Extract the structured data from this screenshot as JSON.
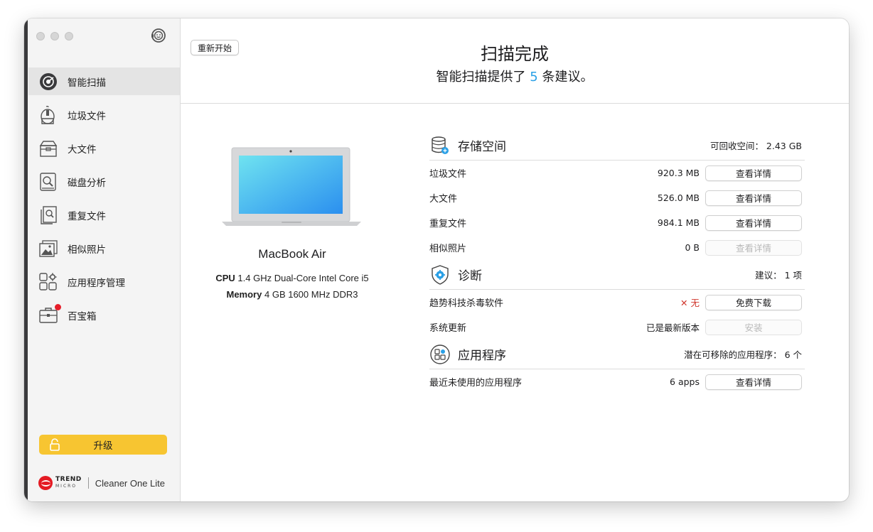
{
  "sidebar": {
    "items": [
      {
        "label": "智能扫描",
        "icon": "smart-scan-icon",
        "active": true
      },
      {
        "label": "垃圾文件",
        "icon": "junk-files-icon"
      },
      {
        "label": "大文件",
        "icon": "big-files-icon"
      },
      {
        "label": "磁盘分析",
        "icon": "disk-analysis-icon"
      },
      {
        "label": "重复文件",
        "icon": "duplicate-files-icon"
      },
      {
        "label": "相似照片",
        "icon": "similar-photos-icon"
      },
      {
        "label": "应用程序管理",
        "icon": "app-manager-icon"
      },
      {
        "label": "百宝箱",
        "icon": "toolbox-icon",
        "badge": true
      }
    ],
    "upgrade_label": "升级",
    "brand": {
      "company_line1": "TREND",
      "company_line2": "MICRO",
      "product": "Cleaner One Lite"
    }
  },
  "header": {
    "restart_label": "重新开始",
    "title": "扫描完成",
    "subtitle_prefix": "智能扫描提供了",
    "subtitle_count": "5",
    "subtitle_suffix": "条建议。"
  },
  "device": {
    "name": "MacBook Air",
    "cpu_label": "CPU",
    "cpu_value": "1.4 GHz Dual-Core Intel Core i5",
    "memory_label": "Memory",
    "memory_value": "4 GB 1600 MHz DDR3"
  },
  "sections": {
    "storage": {
      "title": "存储空间",
      "info": "可回收空间： 2.43 GB",
      "rows": [
        {
          "label": "垃圾文件",
          "value": "920.3 MB",
          "button": "查看详情",
          "enabled": true
        },
        {
          "label": "大文件",
          "value": "526.0 MB",
          "button": "查看详情",
          "enabled": true
        },
        {
          "label": "重复文件",
          "value": "984.1 MB",
          "button": "查看详情",
          "enabled": true
        },
        {
          "label": "相似照片",
          "value": "0 B",
          "button": "查看详情",
          "enabled": false
        }
      ]
    },
    "diagnosis": {
      "title": "诊断",
      "info": "建议： 1 项",
      "rows": [
        {
          "label": "趋势科技杀毒软件",
          "value": "✕  无",
          "button": "免费下载",
          "enabled": true
        },
        {
          "label": "系统更新",
          "value": "已是最新版本",
          "button": "安装",
          "enabled": false
        }
      ]
    },
    "apps": {
      "title": "应用程序",
      "info": "潜在可移除的应用程序： 6 个",
      "rows": [
        {
          "label": "最近未使用的应用程序",
          "value": "6 apps",
          "button": "查看详情",
          "enabled": true
        }
      ]
    }
  },
  "colors": {
    "accent": "#2aa0e6",
    "upgrade": "#f7c531",
    "warning": "#d0352b"
  }
}
